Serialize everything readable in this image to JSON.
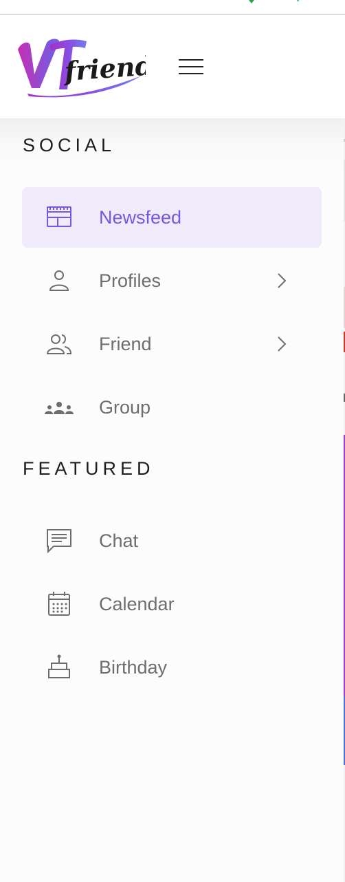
{
  "brand": {
    "logo_letters": "VT",
    "logo_word": "friends",
    "accent_color": "#7a57e0",
    "active_bg": "#efebfb"
  },
  "header": {
    "menu_icon": "hamburger-icon"
  },
  "sections": [
    {
      "title": "SOCIAL",
      "items": [
        {
          "label": "Newsfeed",
          "icon": "newsfeed-icon",
          "active": true,
          "has_submenu": false
        },
        {
          "label": "Profiles",
          "icon": "user-icon",
          "active": false,
          "has_submenu": true
        },
        {
          "label": "Friend",
          "icon": "friends-icon",
          "active": false,
          "has_submenu": true
        },
        {
          "label": "Group",
          "icon": "group-icon",
          "active": false,
          "has_submenu": false
        }
      ]
    },
    {
      "title": "FEATURED",
      "items": [
        {
          "label": "Chat",
          "icon": "chat-icon",
          "active": false,
          "has_submenu": false
        },
        {
          "label": "Calendar",
          "icon": "calendar-icon",
          "active": false,
          "has_submenu": false
        },
        {
          "label": "Birthday",
          "icon": "cake-icon",
          "active": false,
          "has_submenu": false
        }
      ]
    }
  ]
}
